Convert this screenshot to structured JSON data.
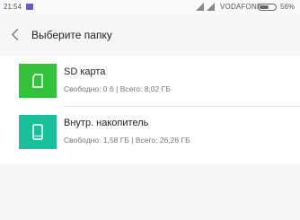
{
  "status_bar": {
    "time": "21:54",
    "carrier": "VODAFONE",
    "battery": "56%",
    "battery_level": 0.56
  },
  "header": {
    "title": "Выберите папку"
  },
  "storages": [
    {
      "name": "SD карта",
      "free_label": "Свободно: 0 б",
      "separator": " | ",
      "total_label": "Всего: 8,02 ГБ",
      "icon": "sd-card-icon",
      "color": "#35c23b"
    },
    {
      "name": "Внутр. накопитель",
      "free_label": "Свободно: 1,58 ГБ",
      "separator": " | ",
      "total_label": "Всего: 26,28 ГБ",
      "icon": "phone-icon",
      "color": "#1bbf9a"
    }
  ]
}
